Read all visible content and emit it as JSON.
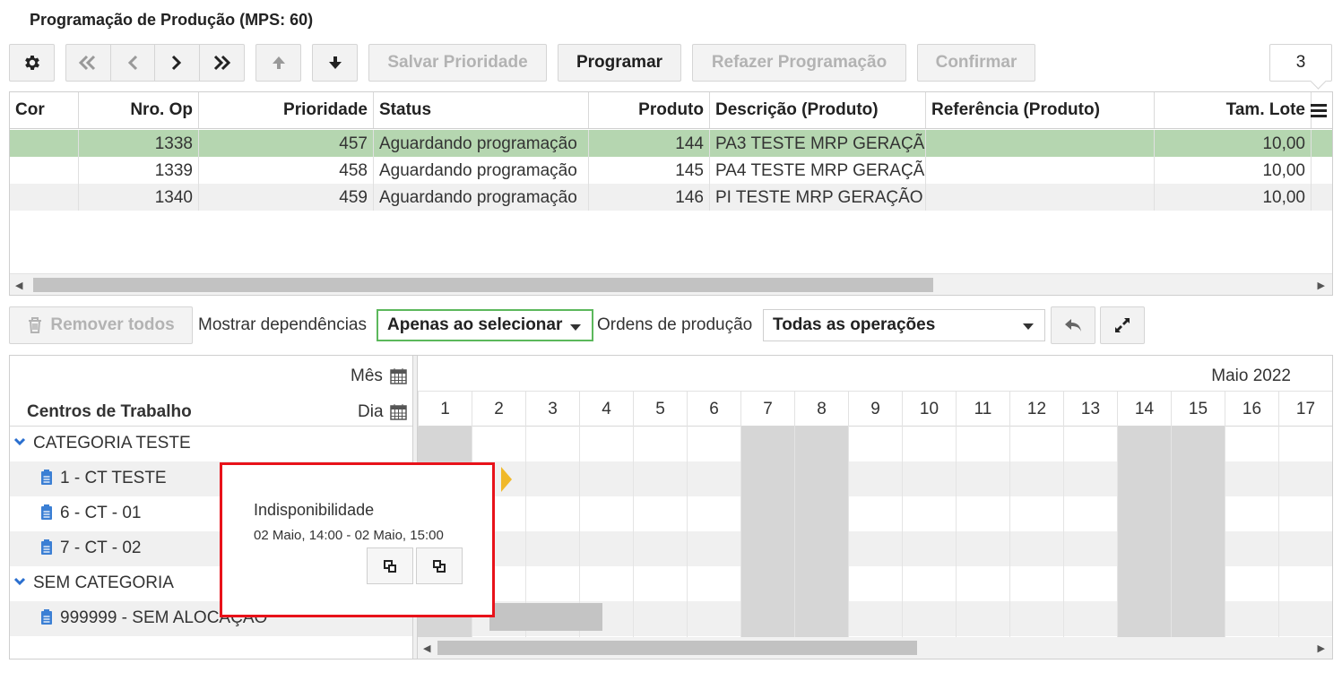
{
  "title": "Programação de Produção (MPS: 60)",
  "toolbar": {
    "save_priority": "Salvar Prioridade",
    "program": "Programar",
    "reprogram": "Refazer Programação",
    "confirm": "Confirmar",
    "counter": "3"
  },
  "table": {
    "columns": [
      "Cor",
      "Nro. Op",
      "Prioridade",
      "Status",
      "Produto",
      "Descrição (Produto)",
      "Referência (Produto)",
      "Tam. Lote"
    ],
    "rows": [
      {
        "cor": "",
        "op": "1338",
        "prioridade": "457",
        "status": "Aguardando programação",
        "produto": "144",
        "descricao": "PA3 TESTE MRP GERAÇÃ",
        "referencia": "",
        "lote": "10,00",
        "selected": true
      },
      {
        "cor": "",
        "op": "1339",
        "prioridade": "458",
        "status": "Aguardando programação",
        "produto": "145",
        "descricao": "PA4 TESTE MRP GERAÇÃ",
        "referencia": "",
        "lote": "10,00",
        "selected": false
      },
      {
        "cor": "",
        "op": "1340",
        "prioridade": "459",
        "status": "Aguardando programação",
        "produto": "146",
        "descricao": "PI TESTE MRP GERAÇÃO",
        "referencia": "",
        "lote": "10,00",
        "selected": false
      }
    ],
    "selected_color": "#b5d6b0"
  },
  "toolbar2": {
    "remove_all": "Remover todos",
    "show_deps_label": "Mostrar dependências",
    "show_deps_value": "Apenas ao selecionar",
    "orders_label": "Ordens de produção",
    "orders_value": "Todas as operações"
  },
  "gantt": {
    "month_label": "Mês",
    "day_label": "Dia",
    "work_centers_label": "Centros de Trabalho",
    "month_value": "Maio 2022",
    "days": [
      "1",
      "2",
      "3",
      "4",
      "5",
      "6",
      "7",
      "8",
      "9",
      "10",
      "11",
      "12",
      "13",
      "14",
      "15",
      "16",
      "17"
    ],
    "tree": [
      {
        "type": "category",
        "label": "CATEGORIA TESTE"
      },
      {
        "type": "item",
        "label": "1 - CT TESTE"
      },
      {
        "type": "item",
        "label": "6 - CT - 01"
      },
      {
        "type": "item",
        "label": "7 - CT - 02"
      },
      {
        "type": "category",
        "label": "SEM CATEGORIA"
      },
      {
        "type": "item",
        "label": "999999 - SEM ALOCAÇÃO"
      }
    ]
  },
  "tooltip": {
    "title": "Indisponibilidade",
    "range": "02 Maio, 14:00 - 02 Maio, 15:00"
  },
  "colors": {
    "accent_green": "#5cb85c",
    "tooltip_border": "#e8121a",
    "clip_icon": "#3b7fd4",
    "bar_yellow": "#f0b92b"
  }
}
